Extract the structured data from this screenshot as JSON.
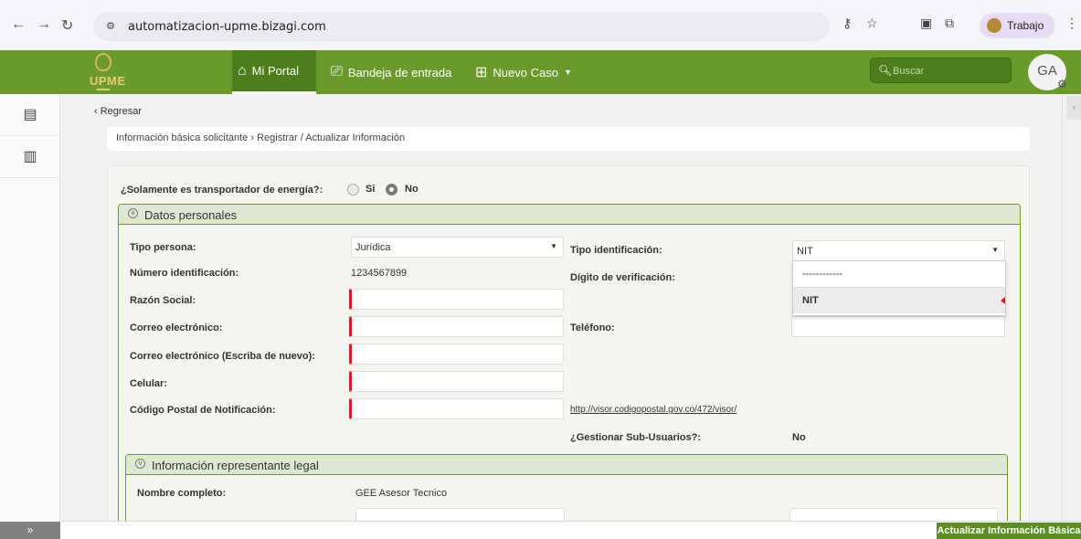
{
  "browser": {
    "url": "automatizacion-upme.bizagi.com",
    "profile_label": "Trabajo"
  },
  "header": {
    "logo_text": "UPME",
    "nav": [
      {
        "label": "Mi Portal",
        "icon": "home-icon"
      },
      {
        "label": "Bandeja de entrada",
        "icon": "inbox-icon"
      },
      {
        "label": "Nuevo Caso",
        "icon": "new-case-icon"
      }
    ],
    "search_placeholder": "Buscar",
    "user_initials": "GA"
  },
  "colors": {
    "brand_green": "#6a9a2c",
    "required_red": "#d62020"
  },
  "page": {
    "back_label": "Regresar",
    "breadcrumb": "Información básica solicitante › Registrar / Actualizar Información",
    "question": "¿Solamente es transportador de energía?:",
    "radio_options": [
      "Si",
      "No"
    ],
    "radio_selected": "No"
  },
  "datos_personales": {
    "title": "Datos personales",
    "tipo_persona_label": "Tipo persona:",
    "tipo_persona_value": "Jurídica",
    "tipo_identificacion_label": "Tipo identificación:",
    "tipo_identificacion_value": "NIT",
    "numero_identificacion_label": "Número identificación:",
    "numero_identificacion_value": "1234567899",
    "digito_verificacion_label": "Dígito de verificación:",
    "razon_social_label": "Razón Social:",
    "correo_label": "Correo electrónico:",
    "telefono_label": "Teléfono:",
    "correo2_label": "Correo electrónico (Escriba de nuevo):",
    "celular_label": "Celular:",
    "codigo_postal_label": "Código Postal de Notificación:",
    "codigo_postal_link": "http://visor.codigopostal.gov.co/472/visor/",
    "sub_usuarios_label": "¿Gestionar Sub-Usuarios?:",
    "sub_usuarios_value": "No",
    "dropdown_options": [
      "------------",
      "NIT"
    ]
  },
  "representante": {
    "title": "Información representante legal",
    "nombre_label": "Nombre completo:",
    "nombre_value": "GEE Asesor Tecnico"
  },
  "footer": {
    "update_button": "Actualizar Información Básica"
  }
}
